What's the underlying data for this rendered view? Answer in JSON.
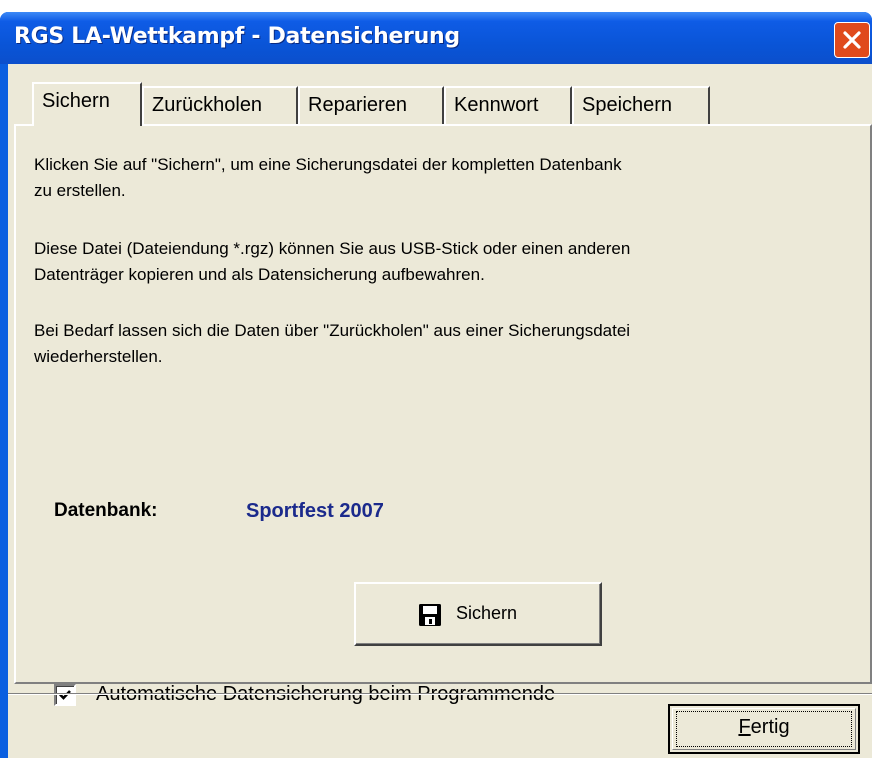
{
  "window": {
    "title": "RGS LA-Wettkampf - Datensicherung"
  },
  "tabs": [
    {
      "label": "Sichern",
      "active": true
    },
    {
      "label": "Zurückholen",
      "active": false
    },
    {
      "label": "Reparieren",
      "active": false
    },
    {
      "label": "Kennwort",
      "active": false
    },
    {
      "label": "Speichern",
      "active": false
    }
  ],
  "panel": {
    "paragraphs": [
      {
        "line1": "Klicken Sie auf  \"Sichern\", um eine Sicherungsdatei der kompletten Datenbank",
        "line2": "zu erstellen."
      },
      {
        "line1": "Diese Datei (Dateiendung *.rgz) können Sie aus USB-Stick oder einen anderen",
        "line2": "Datenträger kopieren und als Datensicherung aufbewahren."
      },
      {
        "line1": "Bei Bedarf lassen sich die Daten über \"Zurückholen\" aus einer Sicherungsdatei",
        "line2": "wiederherstellen."
      }
    ],
    "database_label": "Datenbank:",
    "database_value": "Sportfest 2007",
    "save_button_label": "Sichern",
    "auto_backup": {
      "label": "Automatische Datensicherung beim Programmende",
      "checked": true
    }
  },
  "footer": {
    "done_button_rest": "ertig",
    "done_button_accel": "F"
  },
  "colors": {
    "titlebar": "#0a55d8",
    "dialog_bg": "#ece9d8",
    "db_value": "#1b2a8c",
    "close": "#e04a1c"
  }
}
